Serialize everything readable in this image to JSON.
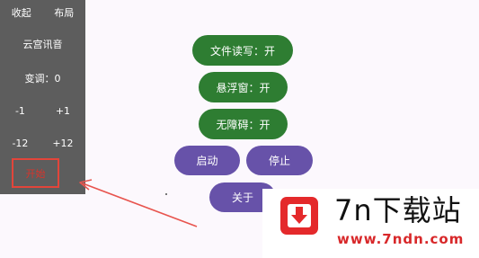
{
  "panel": {
    "collapse_label": "收起",
    "layout_label": "布局",
    "title": "云宫讯音",
    "pitch_label": "变调：0",
    "minus1": "-1",
    "plus1": "+1",
    "minus12": "-12",
    "plus12": "+12",
    "start_label": "开始"
  },
  "controls": {
    "file_rw": "文件读写：开",
    "floating_window": "悬浮窗：开",
    "accessibility": "无障碍：开",
    "launch": "启动",
    "stop": "停止",
    "about": "关于"
  },
  "watermark": {
    "title": "7n下载站",
    "url": "www.7ndn.com"
  },
  "colors": {
    "panel_bg": "#5d5d5d",
    "green": "#2e7d32",
    "purple": "#6752a9",
    "highlight_red": "#e2453a",
    "logo_red": "#e4292b"
  }
}
